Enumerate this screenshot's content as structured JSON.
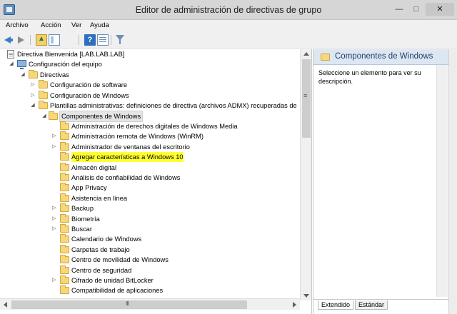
{
  "window": {
    "title": "Editor de administración de directivas de grupo",
    "min_glyph": "—",
    "max_glyph": "□",
    "close_glyph": "✕"
  },
  "menu": [
    "Archivo",
    "Acción",
    "Ver",
    "Ayuda"
  ],
  "toolbar": {
    "icons": [
      "back-arrow-icon",
      "forward-arrow-icon",
      "up-folder-icon",
      "show-hide-tree-icon",
      "help-icon",
      "properties-icon",
      "filter-icon"
    ],
    "help_glyph": "?"
  },
  "tree": {
    "root": "Directiva Bienvenida [LAB.LAB.LAB]",
    "computer_config": "Configuración del equipo",
    "policies": "Directivas",
    "software": "Configuración de software",
    "windows_config": "Configuración de Windows",
    "admin_templates": "Plantillas administrativas: definiciones de directiva (archivos ADMX) recuperadas de",
    "windows_components": "Componentes de Windows",
    "children": [
      {
        "label": "Administración de derechos digitales de Windows Media",
        "expandable": false
      },
      {
        "label": "Administración remota de Windows (WinRM)",
        "expandable": true
      },
      {
        "label": "Administrador de ventanas del escritorio",
        "expandable": true
      },
      {
        "label": "Agregar características a Windows 10",
        "expandable": false,
        "highlighted": true
      },
      {
        "label": "Almacén digital",
        "expandable": false
      },
      {
        "label": "Análisis de confiabilidad de Windows",
        "expandable": false
      },
      {
        "label": "App Privacy",
        "expandable": false
      },
      {
        "label": "Asistencia en línea",
        "expandable": false
      },
      {
        "label": "Backup",
        "expandable": true
      },
      {
        "label": "Biometría",
        "expandable": true
      },
      {
        "label": "Buscar",
        "expandable": true
      },
      {
        "label": "Calendario de Windows",
        "expandable": false
      },
      {
        "label": "Carpetas de trabajo",
        "expandable": false
      },
      {
        "label": "Centro de movilidad de Windows",
        "expandable": false
      },
      {
        "label": "Centro de seguridad",
        "expandable": false
      },
      {
        "label": "Cifrado de unidad BitLocker",
        "expandable": true
      },
      {
        "label": "Compatibilidad de aplicaciones",
        "expandable": false
      }
    ]
  },
  "detail": {
    "header": "Componentes de Windows",
    "text": "Seleccione un elemento para ver su descripción.",
    "tabs": [
      "Extendido",
      "Estándar"
    ]
  },
  "colors": {
    "highlight": "#ffff33",
    "folder": "#f6d77b",
    "detail_header_bg": "#dde7f2"
  }
}
